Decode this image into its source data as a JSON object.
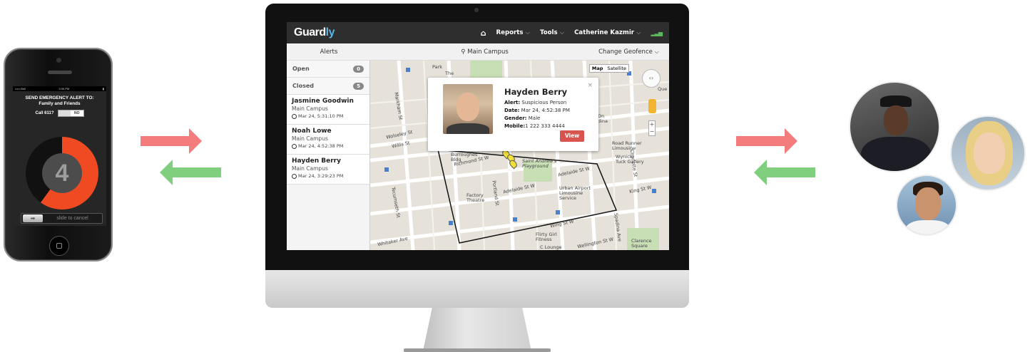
{
  "phone": {
    "status_carrier": "••••• Bell",
    "status_time": "3:30 PM",
    "status_battery": "▮",
    "alert_title_line1": "SEND EMERGENCY ALERT TO:",
    "alert_title_line2": "Family and Friends",
    "call_label": "Call 611?",
    "call_toggle": "NO",
    "countdown": "4",
    "countdown_progress_fraction": 0.6,
    "slide_text": "slide to cancel"
  },
  "app": {
    "logo_main": "Guard",
    "logo_accent": "ly",
    "nav": {
      "home_icon": "⌂",
      "reports": "Reports",
      "tools": "Tools",
      "user": "Catherine Kazmir",
      "caret": "⌵",
      "signal": "▂▃▅"
    },
    "subbar": {
      "alerts": "Alerts",
      "pin_icon": "⚲",
      "campus": "Main Campus",
      "geofence": "Change Geofence ⌵"
    },
    "sidebar": {
      "open_label": "Open",
      "open_count": "0",
      "closed_label": "Closed",
      "closed_count": "5",
      "alerts": [
        {
          "name": "Jasmine Goodwin",
          "location": "Main Campus",
          "time": "Mar 24, 5:31:10 PM"
        },
        {
          "name": "Noah Lowe",
          "location": "Main Campus",
          "time": "Mar 24, 4:52:38 PM"
        },
        {
          "name": "Hayden Berry",
          "location": "Main Campus",
          "time": "Mar 24, 3:29:23 PM"
        }
      ]
    },
    "map": {
      "toggle_map": "Map",
      "toggle_satellite": "Satellite",
      "zoom_in": "+",
      "zoom_out": "−",
      "labels": {
        "richmond": "Richmond St W",
        "adelaide": "Adelaide St W",
        "king": "King St W",
        "st_andrews": "Saint Andrew's Playground",
        "urban_airport": "Urban Airport Limousine Service",
        "factory": "Factory Theatre",
        "burroughes": "Burroughes Bldg",
        "flirty": "Flirty Girl Fitness",
        "road_runner": "Road Runner Limousine",
        "wynick": "Wynick/ Tuck Gallery",
        "whitaker": "Whitaker Ave",
        "wolseley": "Wolseley St",
        "willis": "Willis St",
        "markham": "Markham St",
        "tecumseth": "Tecumseth St",
        "portland": "Portland St",
        "spadina": "Spadina Ave",
        "charlotte": "Charlotte St",
        "clarence": "Clarence Square",
        "wellington": "Wellington St W",
        "park": "Park",
        "the": "The",
        "on_dina": "On dina",
        "que": "Que",
        "bathurst": "Bathurst St",
        "wing": "Wing St W",
        "c_lounge": "C Lounge",
        "portland2": "Portland"
      },
      "popup": {
        "name": "Hayden Berry",
        "alert_label": "Alert:",
        "alert_value": "Suspicious Person",
        "date_label": "Date:",
        "date_value": "Mar 24, 4:52:38 PM",
        "gender_label": "Gender:",
        "gender_value": "Male",
        "mobile_label": "Mobile:",
        "mobile_value": "1 222 333 4444",
        "view_button": "View",
        "close": "×"
      }
    }
  },
  "colors": {
    "arrow_red": "#f47c7c",
    "arrow_green": "#7fcf7f",
    "accent_blue": "#59b4e8",
    "view_red": "#d9534f",
    "countdown_orange": "#f04a22"
  }
}
